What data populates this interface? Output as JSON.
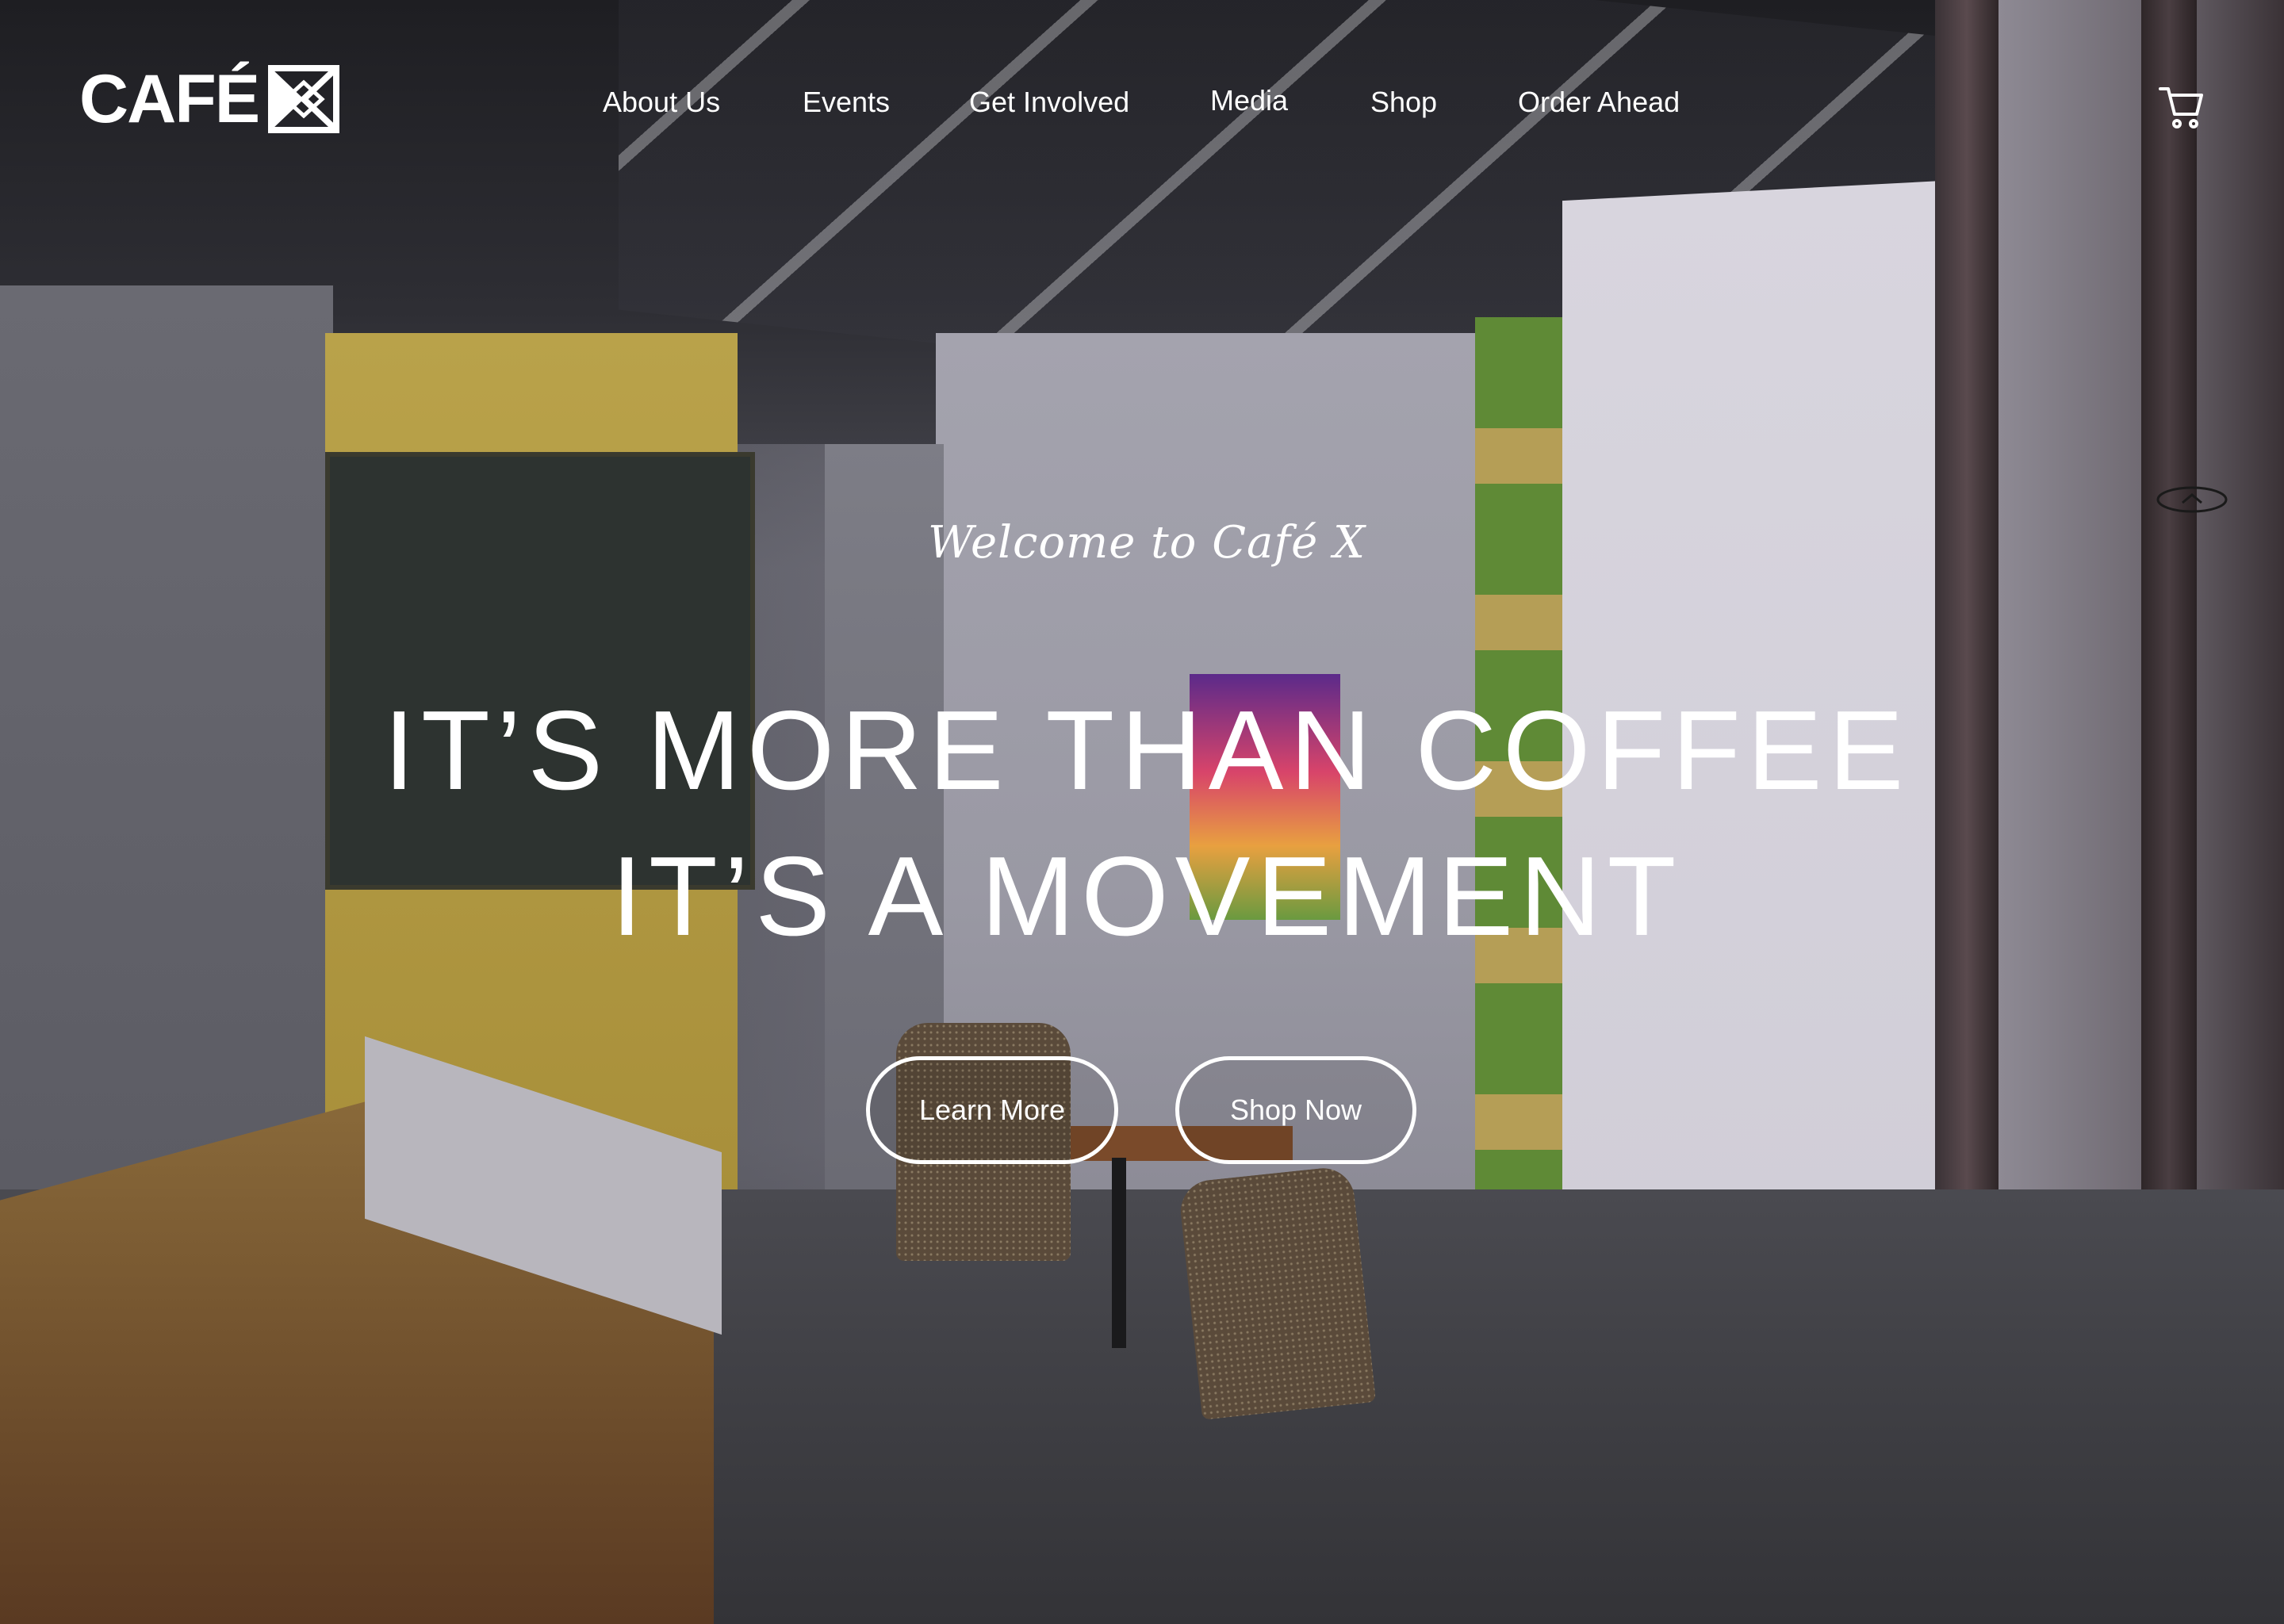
{
  "brand": {
    "logo_text": "CAFÉ",
    "logo_icon": "x-mark-icon"
  },
  "nav": {
    "items": [
      {
        "label": "About Us"
      },
      {
        "label": "Events"
      },
      {
        "label": "Get Involved"
      },
      {
        "label": "Media"
      },
      {
        "label": "Shop"
      },
      {
        "label": "Order Ahead"
      }
    ],
    "cart_icon": "cart-icon"
  },
  "hero": {
    "welcome": "Welcome to Café X",
    "headline_line1": "IT’S MORE THAN COFFEE",
    "headline_line2": "IT’S A MOVEMENT",
    "primary_button": "Learn More",
    "secondary_button": "Shop Now"
  },
  "scroll_to_top_icon": "chevron-up-icon",
  "colors": {
    "text": "#ffffff",
    "button_border": "#ffffff"
  }
}
